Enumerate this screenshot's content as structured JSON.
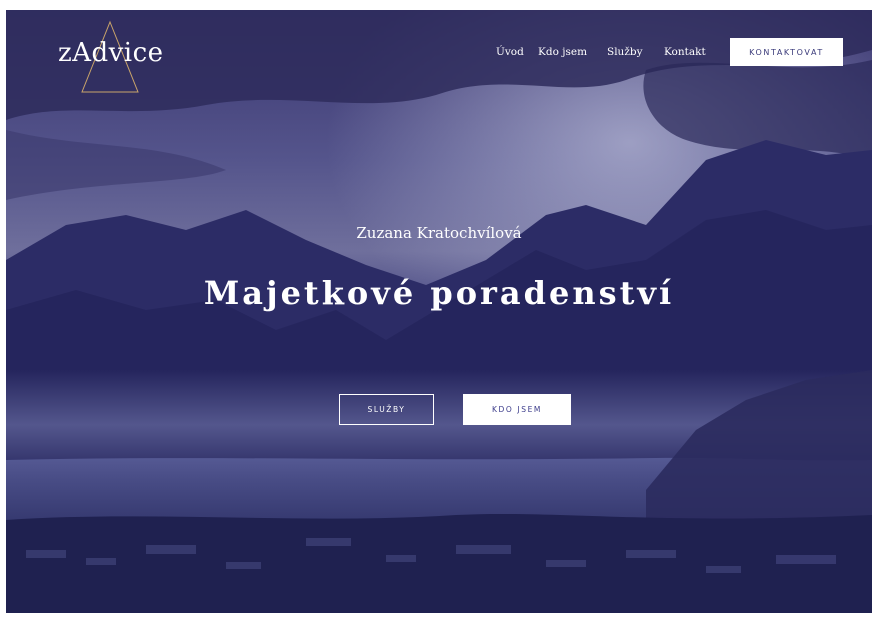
{
  "header": {
    "logo_text": "zAdvice",
    "nav": [
      {
        "label": "Úvod"
      },
      {
        "label": "Kdo jsem"
      },
      {
        "label": "Služby"
      },
      {
        "label": "Kontakt"
      }
    ],
    "cta_label": "KONTAKTOVAT"
  },
  "hero": {
    "subtitle": "Zuzana Kratochvílová",
    "headline": "Majetkové poradenství",
    "button_outline_label": "SLUŽBY",
    "button_solid_label": "KDO JSEM"
  },
  "colors": {
    "overlay": "#2b2966",
    "logo_triangle": "#c9a46a",
    "cta_text": "#3a3a7a",
    "button_text": "#3b3b8a"
  },
  "icons": {
    "logo_mark": "triangle-icon"
  }
}
